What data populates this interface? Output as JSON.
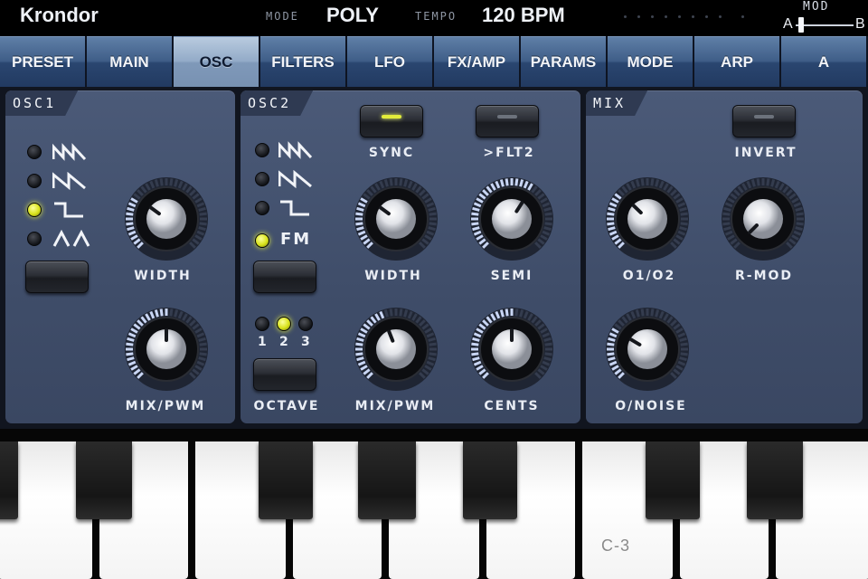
{
  "app": {
    "title": "Krondor"
  },
  "status": {
    "mode_label": "MODE",
    "mode_value": "POLY",
    "tempo_label": "TEMPO",
    "tempo_value": "120 BPM",
    "mod_label": "MOD",
    "mod_a": "A",
    "mod_b": "B",
    "mod_position": 0.05
  },
  "tabs": [
    {
      "label": "PRESET",
      "active": false
    },
    {
      "label": "MAIN",
      "active": false
    },
    {
      "label": "OSC",
      "active": true
    },
    {
      "label": "FILTERS",
      "active": false
    },
    {
      "label": "LFO",
      "active": false
    },
    {
      "label": "FX/AMP",
      "active": false
    },
    {
      "label": "PARAMS",
      "active": false
    },
    {
      "label": "MODE",
      "active": false
    },
    {
      "label": "ARP",
      "active": false
    },
    {
      "label": "A",
      "active": false
    }
  ],
  "osc1": {
    "title": "OSC1",
    "waveforms": [
      {
        "icon": "saw-wave-icon",
        "selected": false
      },
      {
        "icon": "sawtooth-wave-icon",
        "selected": false
      },
      {
        "icon": "square-wave-icon",
        "selected": true
      },
      {
        "icon": "triangle-wave-icon",
        "selected": false
      }
    ],
    "width_label": "WIDTH",
    "width_value": 0.3,
    "mixpwm_label": "MIX/PWM",
    "mixpwm_value": 0.5
  },
  "osc2": {
    "title": "OSC2",
    "waveforms": [
      {
        "icon": "saw-wave-icon",
        "selected": false
      },
      {
        "icon": "sawtooth-wave-icon",
        "selected": false
      },
      {
        "icon": "square-wave-icon",
        "selected": false
      },
      {
        "label": "FM",
        "selected": true
      }
    ],
    "sync_label": "SYNC",
    "sync_on": true,
    "flt2_label": ">FLT2",
    "flt2_on": false,
    "width_label": "WIDTH",
    "width_value": 0.3,
    "semi_label": "SEMI",
    "semi_value": 0.62,
    "octave_label": "OCTAVE",
    "octave_options": [
      "1",
      "2",
      "3"
    ],
    "octave_selected": 1,
    "mixpwm_label": "MIX/PWM",
    "mixpwm_value": 0.42,
    "cents_label": "CENTS",
    "cents_value": 0.5
  },
  "mix": {
    "title": "MIX",
    "invert_label": "INVERT",
    "invert_on": false,
    "o1o2_label": "O1/O2",
    "o1o2_value": 0.33,
    "rmod_label": "R-MOD",
    "rmod_value": 0.0,
    "onoise_label": "O/NOISE",
    "onoise_value": 0.28
  },
  "keyboard": {
    "note_label": "C-3"
  },
  "colors": {
    "led_on": "#e3ec3b",
    "tab_active": "#93abc8",
    "tab": "#3f5e88",
    "panel": "#45536f"
  }
}
